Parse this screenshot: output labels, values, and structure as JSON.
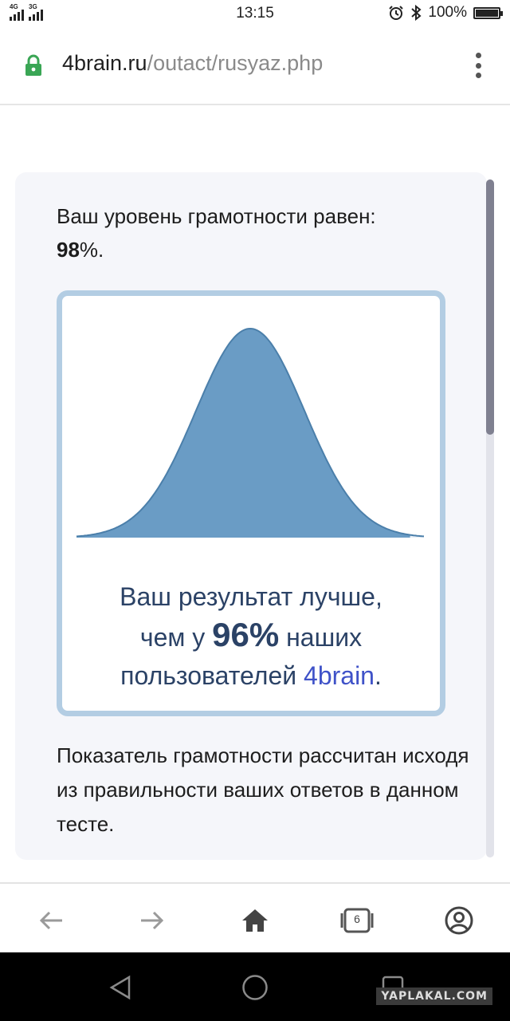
{
  "status_bar": {
    "signal1_label": "4G",
    "signal2_label": "3G",
    "time": "13:15",
    "battery": "100%"
  },
  "browser": {
    "url_host": "4brain.ru",
    "url_path": "/outact/rusyaz.php"
  },
  "result": {
    "literacy_text": "Ваш уровень грамотности равен:",
    "literacy_value": "98",
    "literacy_suffix": "%.",
    "comparison_line1": "Ваш результат лучше,",
    "comparison_prefix": "чем у ",
    "comparison_pct": "96%",
    "comparison_suffix": " наших",
    "comparison_line3_prefix": "пользователей ",
    "comparison_brand": "4brain",
    "comparison_end": ".",
    "explanation": "Показатель грамотности рассчитан исходя из правильности ваших ответов в данном тесте.",
    "percentile_position": 0.96
  },
  "bottom_nav": {
    "tabs_count": "6"
  },
  "watermark": "YAPLAKAL.COM",
  "colors": {
    "curve_fill": "#6a9cc5",
    "curve_stroke": "#4b7faa",
    "box_border": "#b3cde3",
    "result_text": "#2b4266",
    "brand_link": "#3f52c8",
    "lock_green": "#3aa655"
  }
}
